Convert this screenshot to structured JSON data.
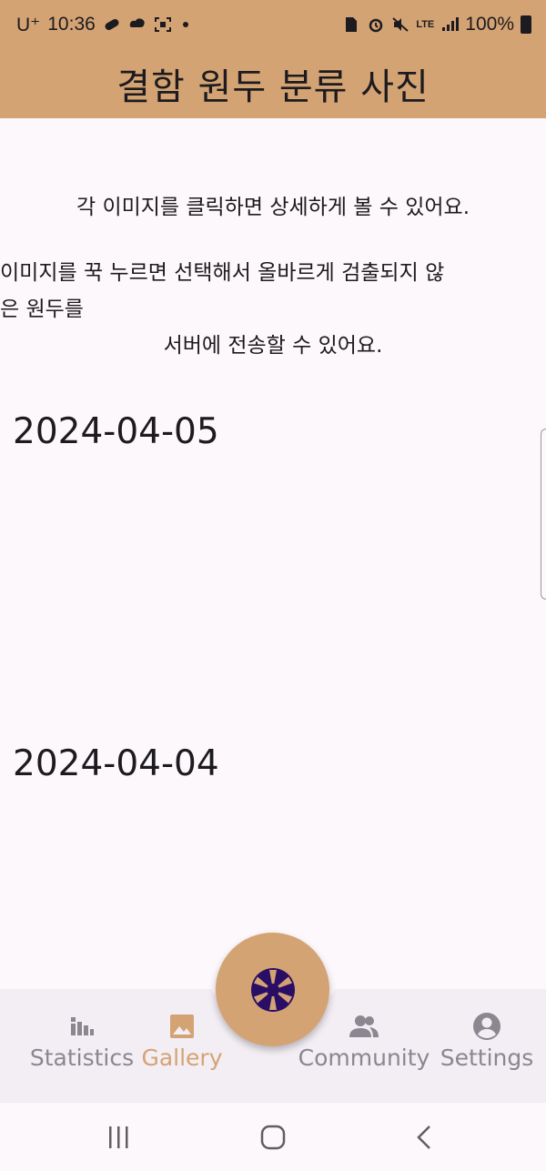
{
  "status_bar": {
    "carrier": "U⁺",
    "time": "10:36",
    "network": "LTE",
    "battery": "100%"
  },
  "app_bar": {
    "title": "결함 원두 분류 사진"
  },
  "instructions": {
    "line1": "각 이미지를 클릭하면 상세하게 볼 수 있어요.",
    "line2": "이미지를 꾹 누르면 선택해서 올바르게 검출되지 않",
    "line3": "은 원두를",
    "line4": "서버에 전송할 수 있어요."
  },
  "gallery": {
    "dates": [
      "2024-04-05",
      "2024-04-04"
    ]
  },
  "bottom_nav": {
    "items": [
      {
        "label": "Statistics",
        "icon": "bar-chart-icon",
        "active": false
      },
      {
        "label": "Gallery",
        "icon": "image-icon",
        "active": true
      },
      {
        "label": "Community",
        "icon": "people-icon",
        "active": false
      },
      {
        "label": "Settings",
        "icon": "account-circle-icon",
        "active": false
      }
    ],
    "fab_icon": "camera-shutter-icon"
  },
  "colors": {
    "accent": "#d4a373",
    "active_label": "#d4a373",
    "inactive_label": "#8a8790",
    "fab_icon": "#2a0e66"
  }
}
